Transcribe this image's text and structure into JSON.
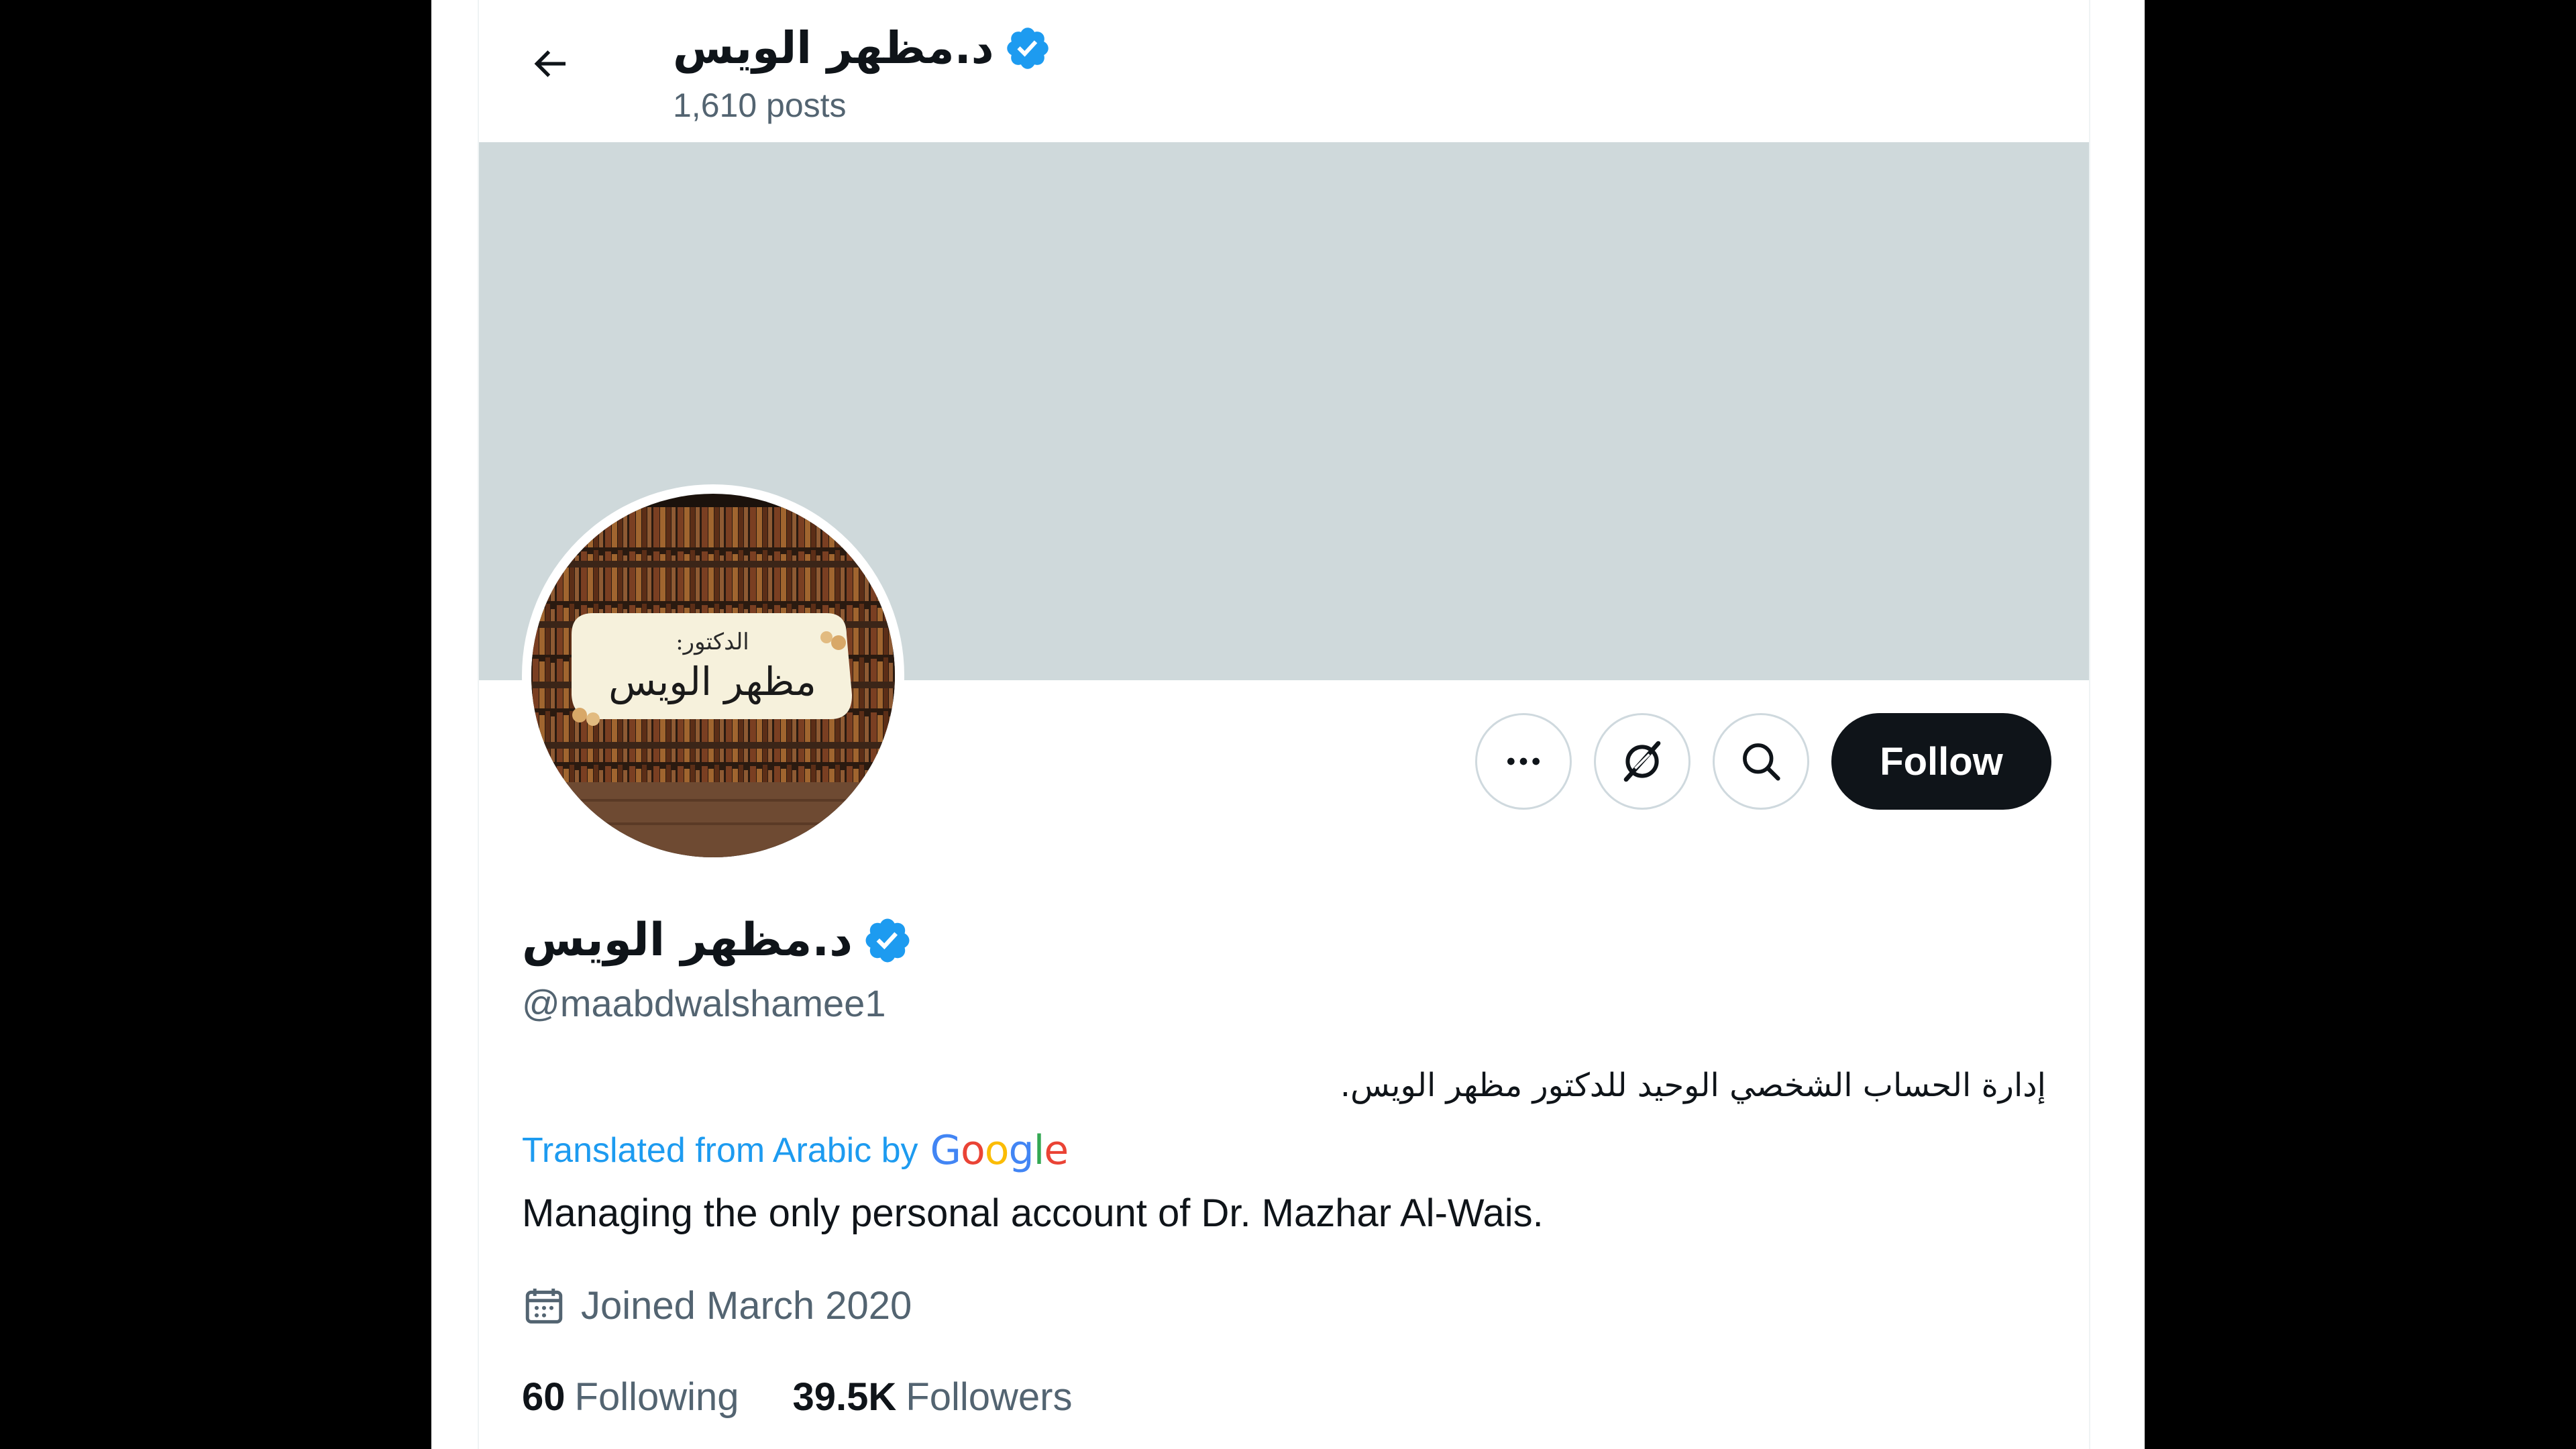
{
  "header": {
    "name": "د.مظهر الويس",
    "posts": "1,610 posts"
  },
  "avatar": {
    "line1": "الدكتور:",
    "line2": "مظهر الويس"
  },
  "actions": {
    "follow_label": "Follow"
  },
  "profile": {
    "name": "د.مظهر الويس",
    "handle": "@maabdwalshamee1",
    "bio_original": "إدارة الحساب الشخصي الوحيد للدكتور مظهر الويس.",
    "translated_label": "Translated from Arabic by",
    "translation_provider": "Google",
    "bio_translated": "Managing the only personal account of Dr. Mazhar Al-Wais.",
    "joined": "Joined March 2020"
  },
  "stats": {
    "following_count": "60",
    "following_label": "Following",
    "followers_count": "39.5K",
    "followers_label": "Followers"
  },
  "icons": {
    "back": "arrow-left-icon",
    "verified": "verified-badge-icon",
    "more": "more-dots-icon",
    "grok": "grok-icon",
    "search": "search-icon",
    "calendar": "calendar-icon"
  },
  "colors": {
    "accent": "#1d9bf0",
    "banner": "#cfd9db",
    "follow_bg": "#0f1419",
    "text_primary": "#0f1419",
    "text_secondary": "#536471"
  }
}
